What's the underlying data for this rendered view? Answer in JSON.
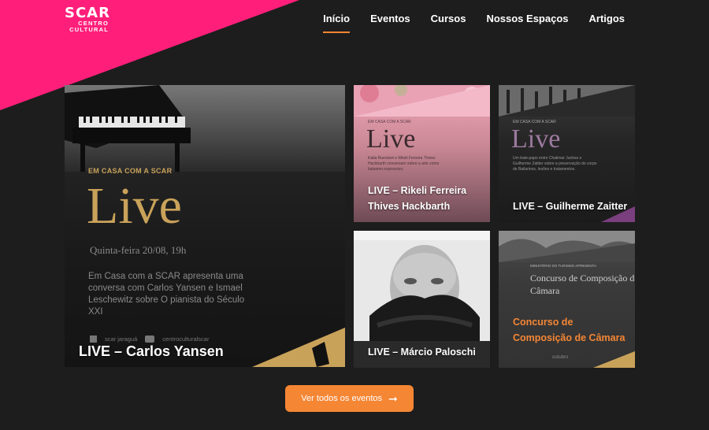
{
  "brand": {
    "logo_main": "SCAR",
    "logo_sub_1": "CENTRO",
    "logo_sub_2": "CULTURAL"
  },
  "nav": {
    "items": [
      {
        "label": "Início",
        "active": true
      },
      {
        "label": "Eventos"
      },
      {
        "label": "Cursos"
      },
      {
        "label": "Nossos Espaços"
      },
      {
        "label": "Artigos"
      }
    ]
  },
  "featured": {
    "title": "LIVE – Carlos Yansen",
    "poster_kicker": "EM CASA COM A SCAR",
    "poster_live": "Live",
    "poster_date": "Quinta-feira 20/08, 19h",
    "poster_desc": "Em Casa com a SCAR apresenta uma conversa com Carlos Yansen e Ismael Leschewitz sobre O pianista do Século XXI",
    "poster_social_1": "scar jaraguá",
    "poster_social_2": "centroculturalscar"
  },
  "events": [
    {
      "title": "LIVE – Rikeli Ferreira Thives Hackbarth",
      "kicker": "EM CASA COM A SCAR",
      "live": "Live",
      "desc": "Katia Rueckert e Rikeli Ferreira Thives Hackbarth conversam sobre a arte como balsamo expressivo."
    },
    {
      "title": "LIVE – Guilherme Zaitter",
      "kicker": "EM CASA COM A SCAR",
      "live": "Live",
      "desc": "Um bate-papo entre Chalimar Junkes e Guilherme Zaitter sobre a preservação do corpo de Bailarinos, lesões e tratamentos."
    },
    {
      "title": "LIVE – Márcio Paloschi"
    },
    {
      "title": "Concurso de Composição de Câmara",
      "kicker": "MINISTÉRIO DO TURISMO APRESENTA",
      "poster_title": "Concurso de Composição de Câmara",
      "poster_note": "outubro"
    }
  ],
  "cta": {
    "label": "Ver todos os eventos",
    "icon": "arrow-right-icon"
  },
  "colors": {
    "pink": "#ff1f7a",
    "orange": "#f58634",
    "gold": "#c9a25a",
    "bg": "#1d1d1d"
  }
}
